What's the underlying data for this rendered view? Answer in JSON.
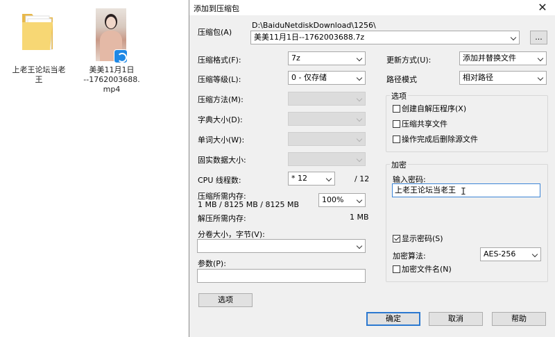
{
  "desktop": {
    "items": [
      {
        "label": "上老王论坛当老\n王",
        "icon": "folder-icon"
      },
      {
        "label": "美美11月1日\n--1762003688.\nmp4",
        "icon": "video-thumbnail"
      }
    ]
  },
  "dialog": {
    "title": "添加到压缩包",
    "close": "✕",
    "archive": {
      "label": "压缩包(A)",
      "path": "D:\\BaiduNetdiskDownload\\1256\\",
      "name": "美美11月1日--1762003688.7z",
      "browse_label": "..."
    },
    "format": {
      "label": "压缩格式(F):",
      "value": "7z"
    },
    "level": {
      "label": "压缩等级(L):",
      "value": "0 - 仅存储"
    },
    "method": {
      "label": "压缩方法(M):",
      "value": ""
    },
    "dict": {
      "label": "字典大小(D):",
      "value": ""
    },
    "word": {
      "label": "单词大小(W):",
      "value": ""
    },
    "solid": {
      "label": "固实数据大小:",
      "value": ""
    },
    "cpu": {
      "label": "CPU 线程数:",
      "value": "* 12",
      "total": "/ 12"
    },
    "mem_compress": {
      "label": "压缩所需内存:",
      "detail": "1 MB / 8125 MB / 8125 MB",
      "percent": "100%"
    },
    "mem_decompress": {
      "label": "解压所需内存:",
      "value": "1 MB"
    },
    "volume": {
      "label": "分卷大小，字节(V):",
      "value": ""
    },
    "params": {
      "label": "参数(P):",
      "value": ""
    },
    "options_button": "选项",
    "update": {
      "label": "更新方式(U):",
      "value": "添加并替换文件"
    },
    "path_mode": {
      "label": "路径模式",
      "value": "相对路径"
    },
    "options_group": {
      "title": "选项",
      "sfx": {
        "label": "创建自解压程序(X)",
        "checked": false
      },
      "shared": {
        "label": "压缩共享文件",
        "checked": false
      },
      "delete": {
        "label": "操作完成后删除源文件",
        "checked": false
      }
    },
    "encryption": {
      "title": "加密",
      "password_label": "输入密码:",
      "password_value": "上老王论坛当老王",
      "show_password": {
        "label": "显示密码(S)",
        "checked": true
      },
      "method_label": "加密算法:",
      "method_value": "AES-256",
      "encrypt_names": {
        "label": "加密文件名(N)",
        "checked": false
      }
    },
    "buttons": {
      "ok": "确定",
      "cancel": "取消",
      "help": "帮助"
    }
  }
}
